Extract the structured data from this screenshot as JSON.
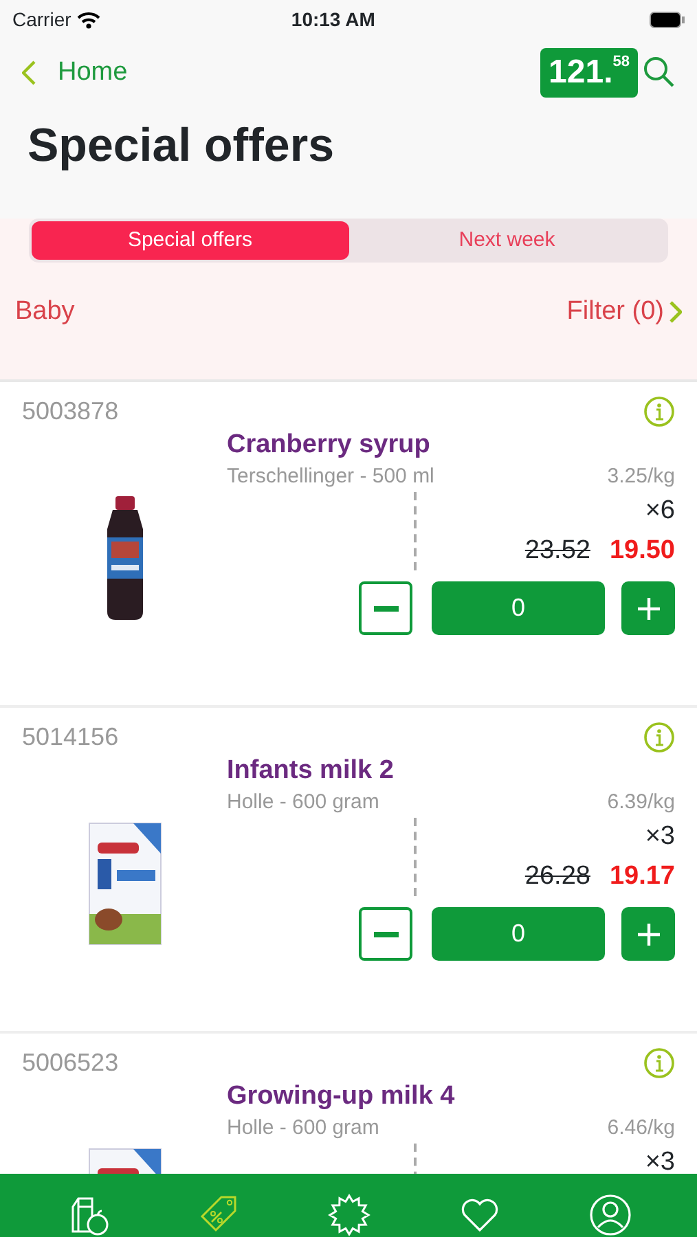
{
  "status_bar": {
    "carrier": "Carrier",
    "time": "10:13 AM"
  },
  "nav": {
    "back": "Home",
    "balance": "121.$^{58}$"
  },
  "title": "Special offers",
  "segments": [
    {
      "label": "Special offers",
      "selected": true
    },
    {
      "label": "Next week",
      "selected": false
    }
  ],
  "filter_bar": {
    "category": "Baby",
    "filter": "Filter (0)"
  },
  "products": [
    {
      "code": "5003878",
      "name": "Cranberry syrup",
      "subtitle": "Terschellinger - 500 ml",
      "unit_price": "3.25/kg",
      "multiplier": "×6",
      "old_price": "23.52",
      "price": "19.50",
      "quantity": "0",
      "kind": "bottle"
    },
    {
      "code": "5014156",
      "name": "Infants milk 2",
      "subtitle": "Holle - 600 gram",
      "unit_price": "6.39/kg",
      "multiplier": "×3",
      "old_price": "26.28",
      "price": "19.17",
      "quantity": "0",
      "kind": "box"
    },
    {
      "code": "5006523",
      "name": "Growing-up milk 4",
      "subtitle": "Holle - 600 gram",
      "unit_price": "6.46/kg",
      "multiplier": "×3",
      "kind": "box"
    }
  ],
  "tab_bar": [
    {
      "kind": "groceries",
      "selected": false
    },
    {
      "kind": "offers",
      "selected": true
    },
    {
      "kind": "new",
      "selected": false
    },
    {
      "kind": "favorites",
      "selected": false
    },
    {
      "kind": "account",
      "selected": false
    }
  ]
}
